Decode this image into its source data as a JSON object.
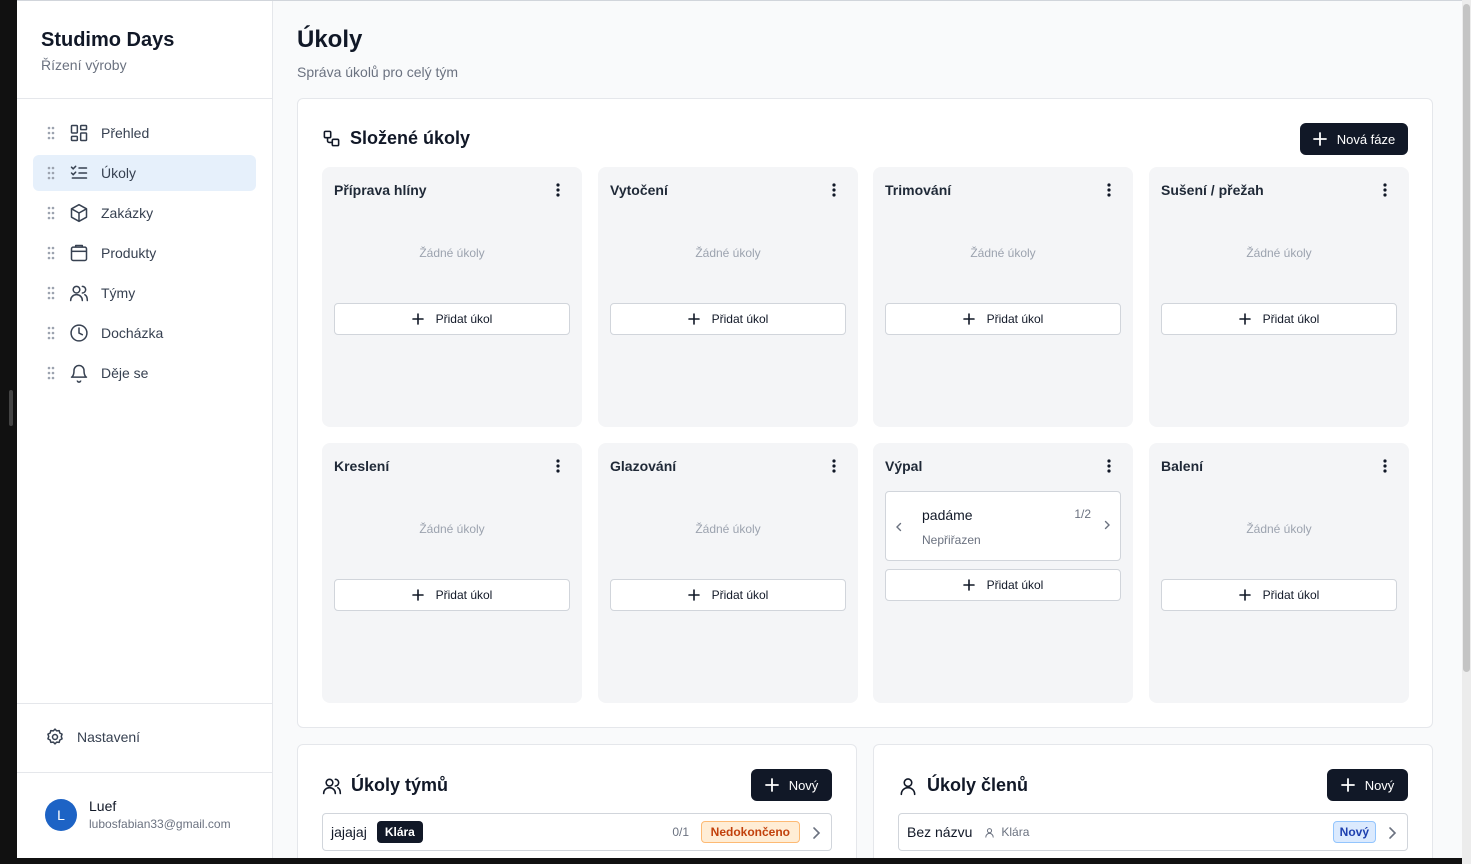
{
  "app": {
    "name": "Studimo Days",
    "subtitle": "Řízení výroby"
  },
  "nav": [
    {
      "label": "Přehled",
      "icon": "dashboard-icon",
      "active": false
    },
    {
      "label": "Úkoly",
      "icon": "tasks-icon",
      "active": true
    },
    {
      "label": "Zakázky",
      "icon": "package-icon",
      "active": false
    },
    {
      "label": "Produkty",
      "icon": "shopping-bag-icon",
      "active": false
    },
    {
      "label": "Týmy",
      "icon": "users-icon",
      "active": false
    },
    {
      "label": "Docházka",
      "icon": "clock-icon",
      "active": false
    },
    {
      "label": "Děje se",
      "icon": "bell-icon",
      "active": false
    }
  ],
  "settings": {
    "label": "Nastavení"
  },
  "user": {
    "initial": "L",
    "name": "Luef",
    "email": "lubosfabian33@gmail.com"
  },
  "page": {
    "title": "Úkoly",
    "subtitle": "Správa úkolů pro celý tým"
  },
  "composite": {
    "title": "Složené úkoly",
    "new_phase_label": "Nová fáze",
    "empty_label": "Žádné úkoly",
    "add_task_label": "Přidat úkol",
    "phases": [
      {
        "title": "Příprava hlíny"
      },
      {
        "title": "Vytočení"
      },
      {
        "title": "Trimování"
      },
      {
        "title": "Sušení / přežah"
      },
      {
        "title": "Kreslení"
      },
      {
        "title": "Glazování"
      },
      {
        "title": "Výpal",
        "task": {
          "name": "padáme",
          "counter": "1/2",
          "assignee": "Nepřiřazen"
        }
      },
      {
        "title": "Balení"
      }
    ]
  },
  "team_tasks": {
    "title": "Úkoly týmů",
    "new_label": "Nový",
    "rows": [
      {
        "name": "jajajaj",
        "team": "Klára",
        "progress": "0/1",
        "status": "Nedokončeno"
      }
    ]
  },
  "member_tasks": {
    "title": "Úkoly členů",
    "new_label": "Nový",
    "rows": [
      {
        "name": "Bez názvu",
        "assignee": "Klára",
        "status": "Nový"
      }
    ]
  },
  "colors": {
    "primary_dark": "#111827",
    "active_nav_bg": "#e6f0fb",
    "avatar_bg": "#1d63c5",
    "status_incomplete": "#c2410c",
    "status_new": "#1e40af"
  }
}
